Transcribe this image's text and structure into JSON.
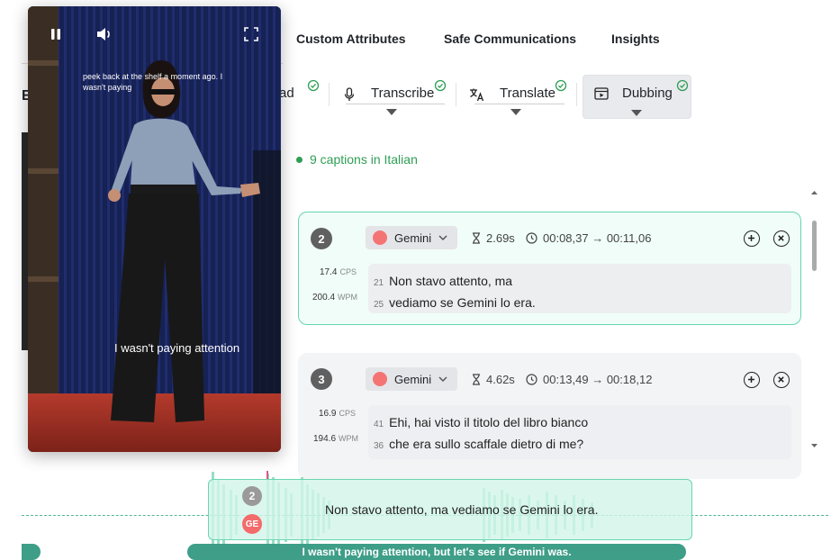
{
  "topnav": {
    "items": [
      "Custom Attributes",
      "Safe Communications",
      "Insights"
    ]
  },
  "left_partial": {
    "letter": "E"
  },
  "tools": {
    "upload_partial": "ad",
    "transcribe": "Transcribe",
    "translate": "Translate",
    "dubbing": "Dubbing"
  },
  "status": {
    "text": "9 captions in Italian"
  },
  "cards": [
    {
      "number": "2",
      "voice": "Gemini",
      "duration": "2.69s",
      "time_range": "00:08,37 → 00:11,06",
      "cps": "17.4",
      "cps_unit": "CPS",
      "wpm": "200.4",
      "wpm_unit": "WPM",
      "lines": [
        {
          "chars": "21",
          "text": "Non stavo attento, ma"
        },
        {
          "chars": "25",
          "text": "vediamo se Gemini lo era."
        }
      ]
    },
    {
      "number": "3",
      "voice": "Gemini",
      "duration": "4.62s",
      "time_range": "00:13,49 → 00:18,12",
      "cps": "16.9",
      "cps_unit": "CPS",
      "wpm": "194.6",
      "wpm_unit": "WPM",
      "lines": [
        {
          "chars": "41",
          "text": "Ehi, hai visto il titolo del libro bianco"
        },
        {
          "chars": "36",
          "text": "che era sullo scaffale dietro di me?"
        }
      ]
    }
  ],
  "video": {
    "subtitle_top": "peek back at the shelf a moment ago. I wasn't paying",
    "subtitle_bottom": "I wasn't paying attention"
  },
  "timeline": {
    "segment_number": "2",
    "voice_initials": "GE",
    "segment_text": "Non stavo attento, ma vediamo se Gemini lo era.",
    "source_text": "I wasn't paying attention, but let's see if Gemini was."
  },
  "colors": {
    "accent_green": "#2f9e55",
    "card_active_border": "#64d6ad",
    "timeline_bar": "#3e9e88",
    "voice_avatar": "#f47474"
  }
}
